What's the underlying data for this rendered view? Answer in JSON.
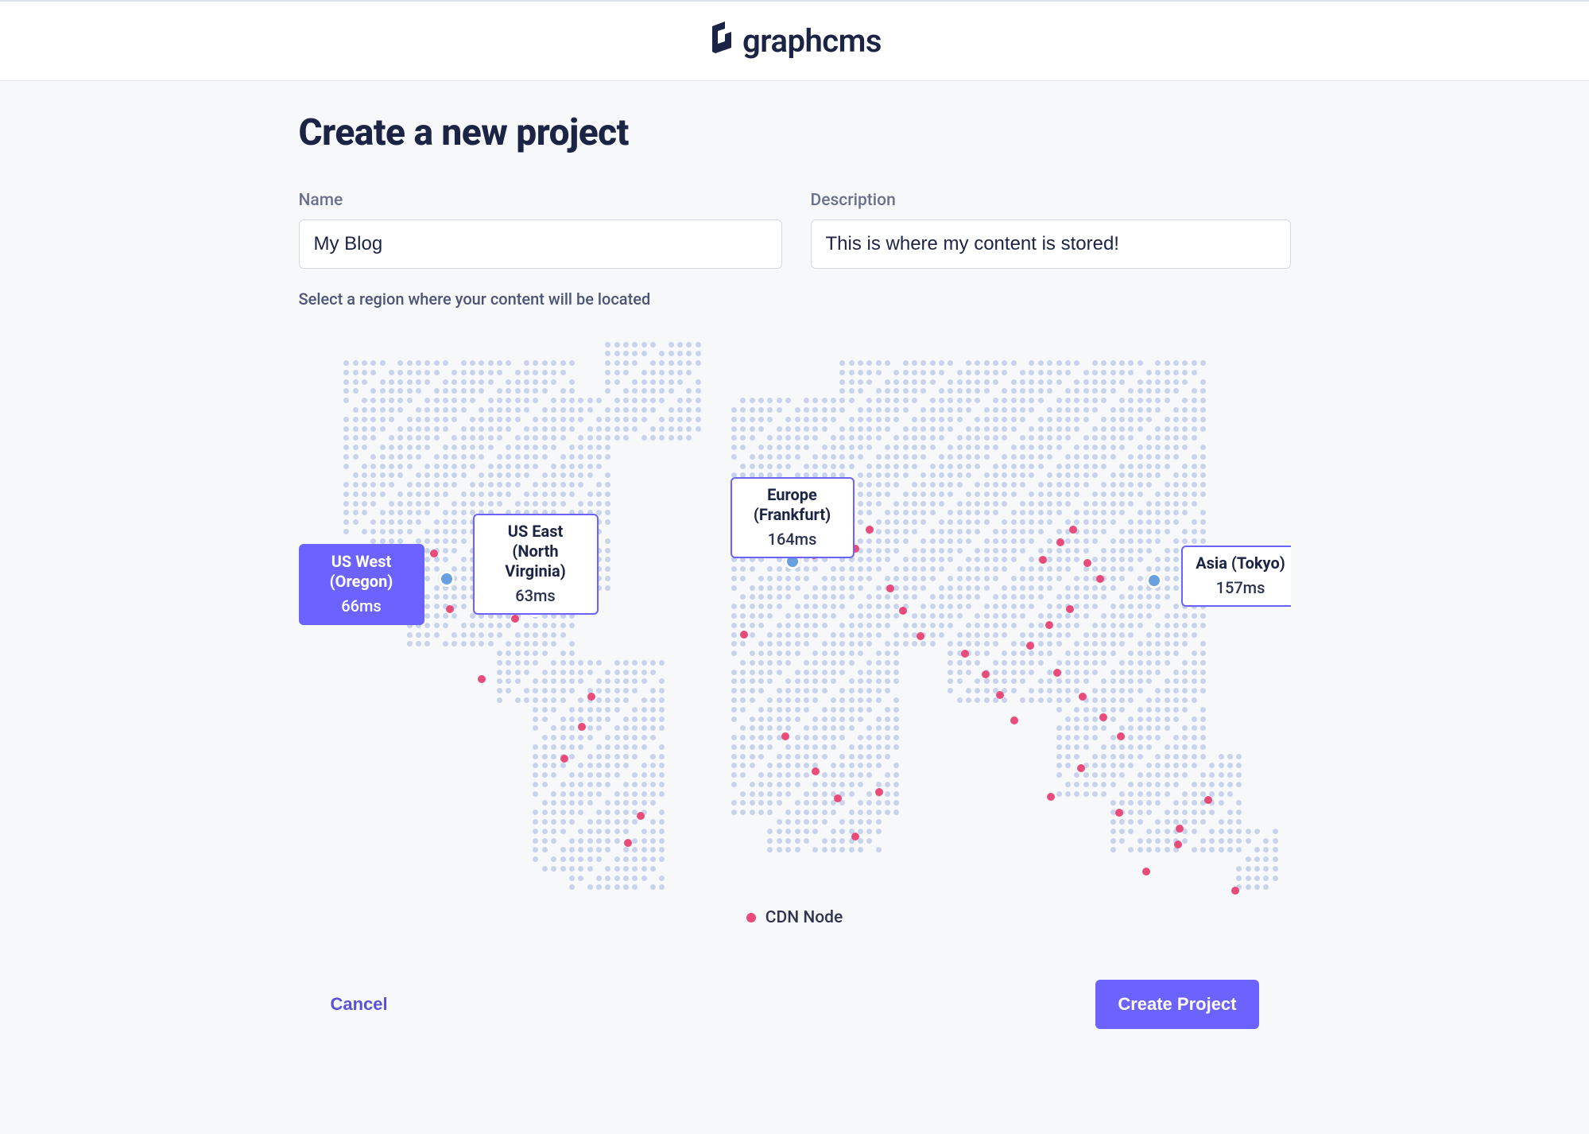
{
  "brand": {
    "name": "graphcms"
  },
  "page": {
    "title": "Create a new project",
    "name_label": "Name",
    "name_value": "My Blog",
    "desc_label": "Description",
    "desc_value": "This is where my content is stored!",
    "region_helper": "Select a region where your content will be located"
  },
  "regions": {
    "us_west": {
      "title": "US West (Oregon)",
      "latency": "66ms",
      "selected": true
    },
    "us_east": {
      "title": "US East (North Virginia)",
      "latency": "63ms",
      "selected": false
    },
    "eu": {
      "title": "Europe (Frankfurt)",
      "latency": "164ms",
      "selected": false
    },
    "asia": {
      "title": "Asia (Tokyo)",
      "latency": "157ms",
      "selected": false
    }
  },
  "legend": {
    "cdn_node": "CDN Node"
  },
  "actions": {
    "cancel": "Cancel",
    "create": "Create Project"
  },
  "colors": {
    "accent": "#6c63ff",
    "cdn": "#e94b7b",
    "region_dot": "#6aa0e0"
  }
}
